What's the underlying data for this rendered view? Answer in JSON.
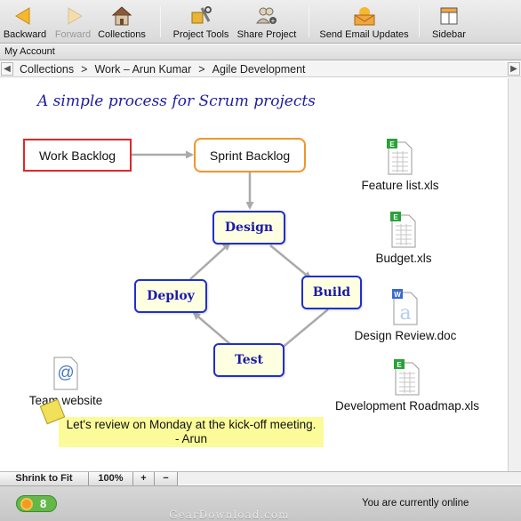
{
  "toolbar": {
    "backward": "Backward",
    "forward": "Forward",
    "collections": "Collections",
    "project_tools": "Project Tools",
    "share_project": "Share Project",
    "send_email_updates": "Send Email Updates",
    "sidebar": "Sidebar"
  },
  "account": {
    "label": "My Account"
  },
  "breadcrumb": {
    "items": [
      "Collections",
      "Work – Arun Kumar",
      "Agile Development"
    ],
    "separator": ">"
  },
  "canvas": {
    "title": "A simple process for Scrum projects",
    "boxes": {
      "work_backlog": "Work Backlog",
      "sprint_backlog": "Sprint Backlog",
      "design": "Design",
      "build": "Build",
      "test": "Test",
      "deploy": "Deploy"
    },
    "files": {
      "feature_list": "Feature list.xls",
      "budget": "Budget.xls",
      "design_review": "Design Review.doc",
      "development_roadmap": "Development Roadmap.xls",
      "team_website": "Team website"
    },
    "file_icons": {
      "excel": "spreadsheet-icon",
      "word": "document-icon",
      "web": "web-link-icon"
    },
    "note": {
      "line1": "Let's review on Monday at the kick-off meeting.",
      "line2": "- Arun"
    }
  },
  "zoom": {
    "shrink_to_fit": "Shrink to Fit",
    "level": "100%",
    "zoom_in": "+",
    "zoom_out": "−"
  },
  "status": {
    "badge_count": "8",
    "online_text": "You are currently online",
    "watermark": "GearDownload.com"
  },
  "colors": {
    "title_blue": "#1e1ea0",
    "step_border": "#1f2fd0",
    "step_fill": "#fefee0",
    "work_backlog_border": "#e0272a",
    "sprint_backlog_border": "#f0962a",
    "arrow_gray": "#aaaaaa",
    "note_yellow": "#fbfb9a",
    "badge_green": "#64b84a"
  }
}
